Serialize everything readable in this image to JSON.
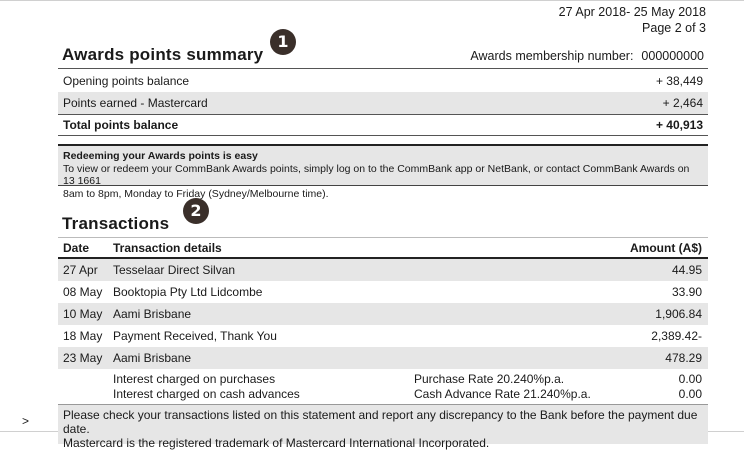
{
  "header": {
    "period": "27 Apr 2018- 25 May 2018",
    "page": "Page 2 of 3"
  },
  "badges": {
    "one": "1",
    "two": "2"
  },
  "summary": {
    "title": "Awards points summary",
    "membership_label": "Awards membership number:",
    "membership_number": "000000000",
    "rows": [
      {
        "label": "Opening points balance",
        "value": "+ 38,449"
      },
      {
        "label": "Points earned - Mastercard",
        "value": "+ 2,464"
      },
      {
        "label": "Total points balance",
        "value": "+ 40,913"
      }
    ]
  },
  "note": {
    "heading": "Redeeming your Awards points is easy",
    "line1": "To view or redeem your CommBank Awards points, simply log on to the CommBank app or NetBank, or contact CommBank Awards on 13 1661",
    "line2": "8am to 8pm, Monday to Friday (Sydney/Melbourne time)."
  },
  "transactions": {
    "title": "Transactions",
    "headers": {
      "date": "Date",
      "details": "Transaction details",
      "amount": "Amount (A$)"
    },
    "rows": [
      {
        "date": "27 Apr",
        "details": "Tesselaar Direct Silvan",
        "amount": "44.95"
      },
      {
        "date": "08 May",
        "details": "Booktopia Pty Ltd Lidcombe",
        "amount": "33.90"
      },
      {
        "date": "10 May",
        "details": "Aami Brisbane",
        "amount": "1,906.84"
      },
      {
        "date": "18 May",
        "details": "Payment Received, Thank You",
        "amount": "2,389.42-"
      },
      {
        "date": "23 May",
        "details": "Aami Brisbane",
        "amount": "478.29"
      }
    ],
    "interest": [
      {
        "label": "Interest charged on purchases",
        "rate": "Purchase Rate 20.240%p.a.",
        "amount": "0.00"
      },
      {
        "label": "Interest charged on cash advances",
        "rate": "Cash Advance Rate 21.240%p.a.",
        "amount": "0.00"
      }
    ]
  },
  "footer": {
    "line1": "Please check your transactions listed on this statement and report any discrepancy to the Bank before the payment due date.",
    "line2": "Mastercard is the registered trademark of Mastercard International Incorporated."
  },
  "nav": {
    "arrow": ">"
  }
}
